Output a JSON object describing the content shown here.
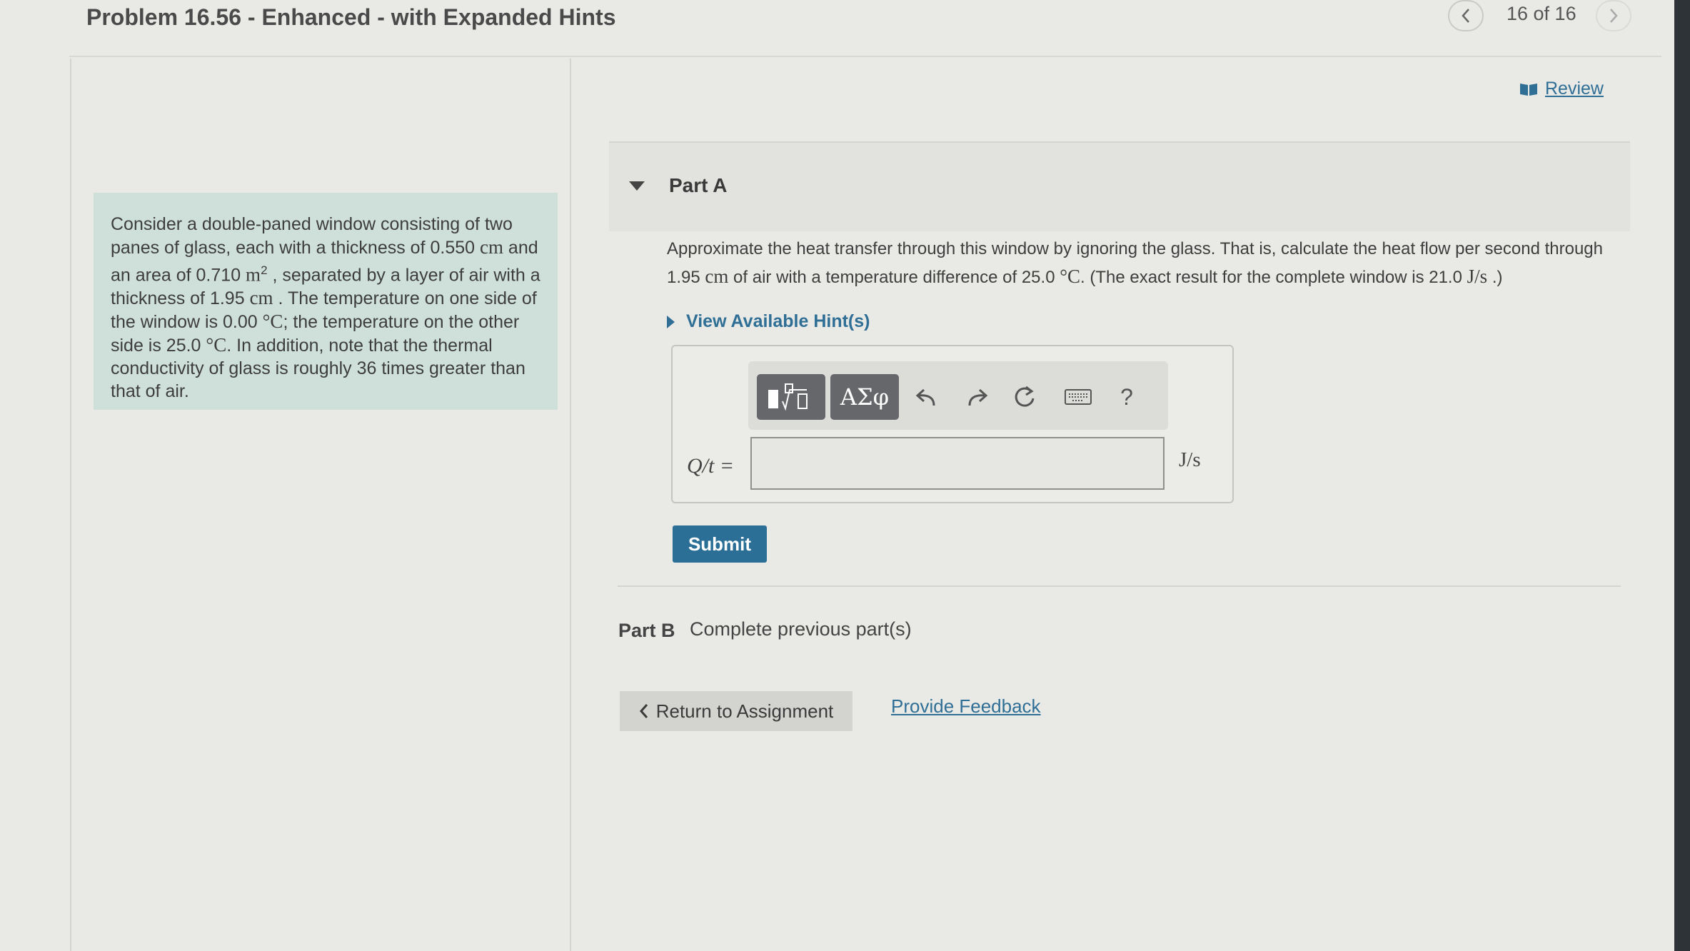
{
  "header": {
    "title": "Problem 16.56 - Enhanced - with Expanded Hints",
    "counter": "16 of 16"
  },
  "review": {
    "label": "Review"
  },
  "problem": {
    "p1": "Consider a double-paned window consisting of two panes of glass, each with a thickness of 0.550 ",
    "u1": "cm",
    "p2": " and an area of 0.710 ",
    "u2": "m",
    "sup2": "2",
    "p3": " , separated by a layer of air with a thickness of 1.95 ",
    "u3": "cm",
    "p4": " . The temperature on one side of the window is 0.00 ",
    "u4": "°C",
    "p5": "; the temperature on the other side is 25.0 ",
    "u5": "°C",
    "p6": ". In addition, note that the thermal conductivity of glass is roughly 36 times greater than that of air."
  },
  "part_a": {
    "title": "Part A",
    "q1": "Approximate the heat transfer through this window by ignoring the glass. That is, calculate the heat flow per second through 1.95 ",
    "qu1": "cm",
    "q2": " of air with a temperature difference of 25.0 ",
    "qu2": "°C",
    "q3": ". (The exact result for the complete window is 21.0 ",
    "qu3": "J/s",
    "q4": " .)",
    "hints_label": "View Available Hint(s)",
    "toolbar": {
      "symbols_label": "ΑΣφ",
      "help_label": "?"
    },
    "variable_label": "Q/t =",
    "answer_value": "",
    "unit": "J/s",
    "submit_label": "Submit"
  },
  "part_b": {
    "label": "Part B",
    "status": "Complete previous part(s)"
  },
  "footer": {
    "return_label": "Return to Assignment",
    "feedback_label": "Provide Feedback"
  },
  "colors": {
    "accent": "#2f6f96",
    "submit": "#2b6f97",
    "problem_bg": "#cfe0da",
    "toolbar_button": "#66676a"
  }
}
